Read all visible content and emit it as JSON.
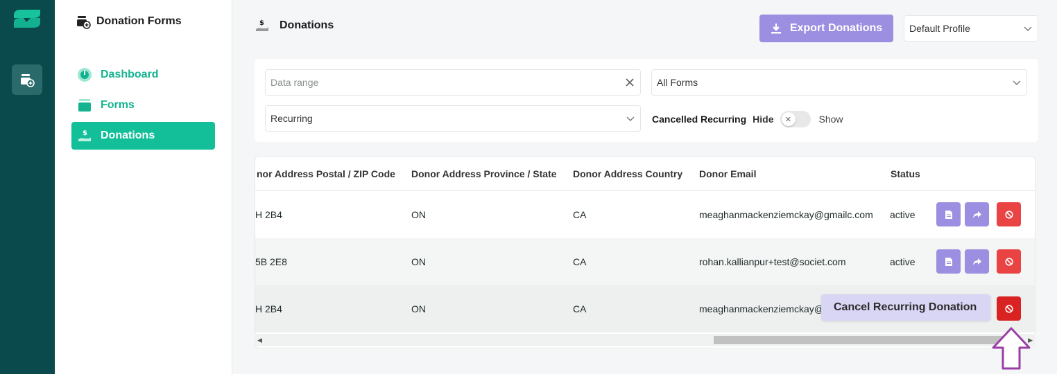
{
  "app": {
    "title": "Donation Forms"
  },
  "sidebar": {
    "items": [
      {
        "label": "Dashboard",
        "icon": "gauge-icon",
        "active": false
      },
      {
        "label": "Forms",
        "icon": "inbox-icon",
        "active": false
      },
      {
        "label": "Donations",
        "icon": "hand-dollar-icon",
        "active": true
      }
    ]
  },
  "page": {
    "title": "Donations",
    "export_label": "Export Donations",
    "profile_select": "Default Profile"
  },
  "filters": {
    "date_range_placeholder": "Data range",
    "forms_select": "All Forms",
    "type_select": "Recurring",
    "cancelled_label": "Cancelled Recurring",
    "hide_label": "Hide",
    "show_label": "Show",
    "toggle_on": false
  },
  "table": {
    "columns": [
      "nor Address Postal / ZIP Code",
      "Donor Address Province / State",
      "Donor Address Country",
      "Donor Email",
      "Status"
    ],
    "rows": [
      {
        "postal": "H 2B4",
        "province": "ON",
        "country": "CA",
        "email": "meaghanmackenziemckay@gmailc.com",
        "status": "active"
      },
      {
        "postal": "5B 2E8",
        "province": "ON",
        "country": "CA",
        "email": "rohan.kallianpur+test@societ.com",
        "status": "active"
      },
      {
        "postal": "H 2B4",
        "province": "ON",
        "country": "CA",
        "email": "meaghanmackenziemckay@gn",
        "status": ""
      }
    ]
  },
  "tooltip": {
    "text": "Cancel Recurring Donation"
  },
  "colors": {
    "rail": "#0a4a4c",
    "accent_green": "#12bf98",
    "accent_purple": "#9c8ee0",
    "danger_red": "#e94343",
    "hint_arrow": "#9a3ea6"
  }
}
